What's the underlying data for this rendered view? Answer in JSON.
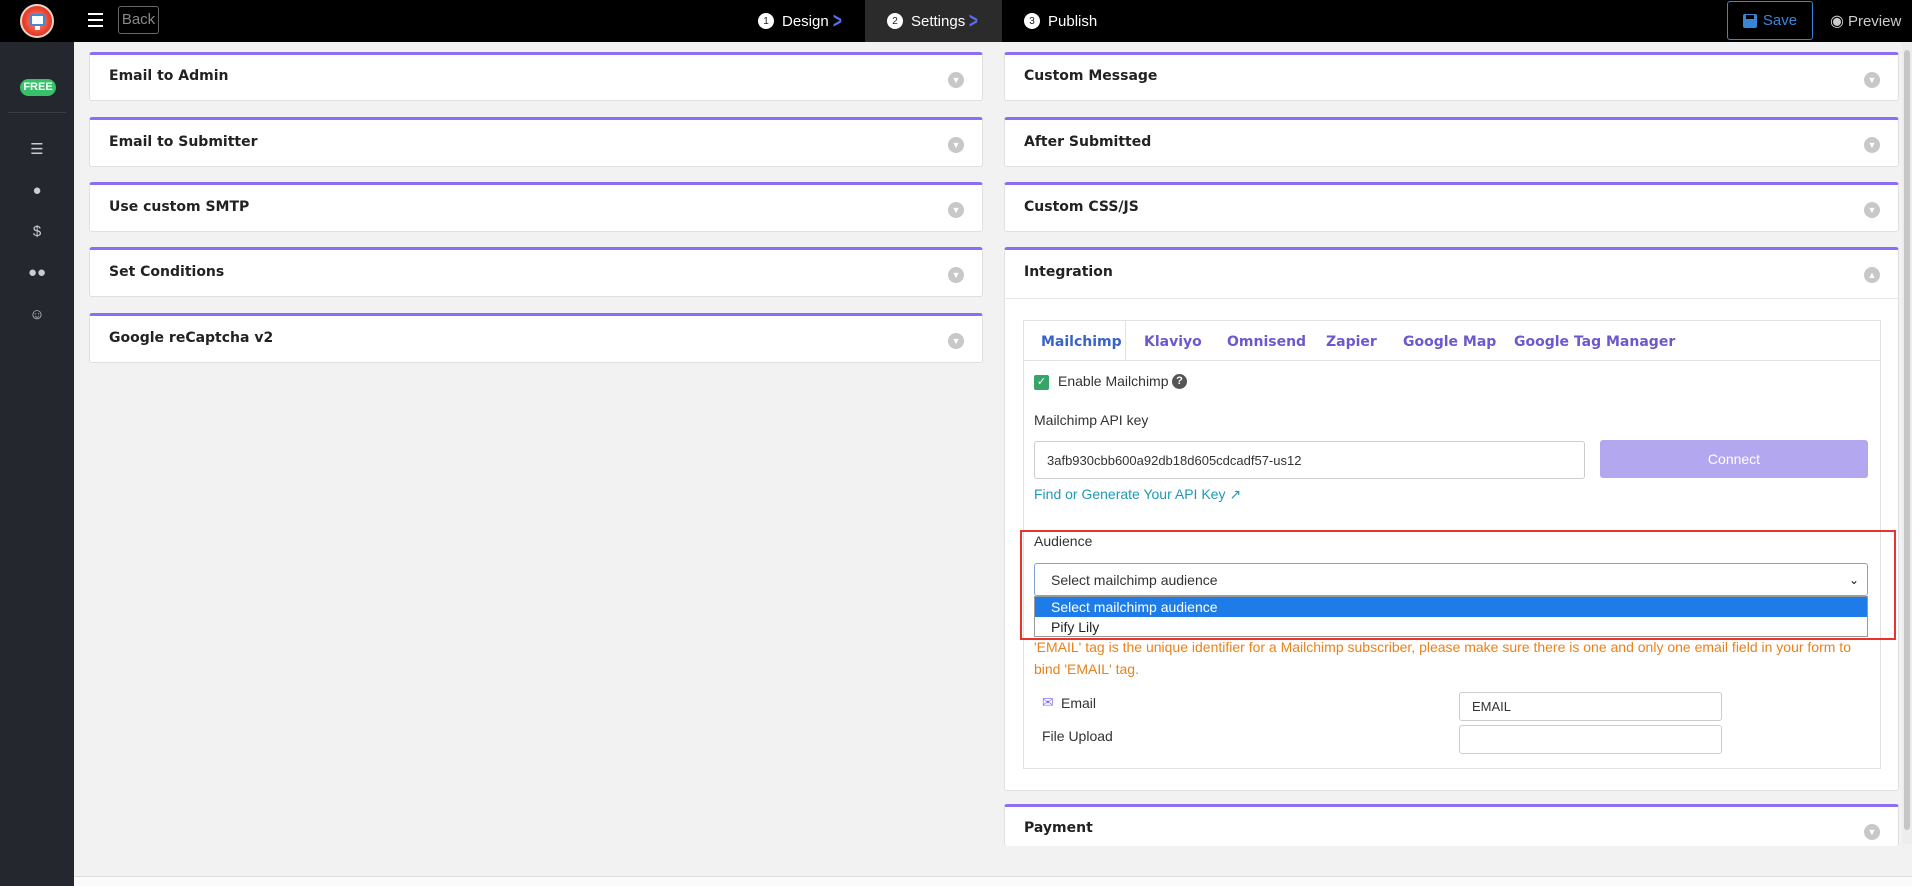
{
  "topbar": {
    "back_label": "Back",
    "steps": [
      {
        "num": "1",
        "label": "Design"
      },
      {
        "num": "2",
        "label": "Settings"
      },
      {
        "num": "3",
        "label": "Publish"
      }
    ],
    "save_label": "Save",
    "preview_label": "Preview"
  },
  "sidebar": {
    "badge": "FREE",
    "icons": [
      "list-icon",
      "user-icon",
      "dollar-icon",
      "users-icon",
      "smile-icon"
    ]
  },
  "left_panels": [
    {
      "title": "Email to Admin"
    },
    {
      "title": "Email to Submitter"
    },
    {
      "title": "Use custom SMTP"
    },
    {
      "title": "Set Conditions"
    },
    {
      "title": "Google reCaptcha v2"
    }
  ],
  "right_panels": [
    {
      "title": "Custom Message"
    },
    {
      "title": "After Submitted"
    },
    {
      "title": "Custom CSS/JS"
    },
    {
      "title": "Integration"
    },
    {
      "title": "Payment"
    }
  ],
  "integration": {
    "tabs": [
      "Mailchimp",
      "Klaviyo",
      "Omnisend",
      "Zapier",
      "Google Map",
      "Google Tag Manager"
    ],
    "active_tab": "Mailchimp",
    "enable_label": "Enable Mailchimp",
    "enabled": true,
    "api_key_label": "Mailchimp API key",
    "api_key_value": "3afb930cbb600a92db18d605cdcadf57-us12",
    "connect_label": "Connect",
    "api_link": "Find or Generate Your API Key",
    "audience_label": "Audience",
    "audience_selected": "Select mailchimp audience",
    "audience_options": [
      "Select mailchimp audience",
      "Pify Lily"
    ],
    "note": "'EMAIL' tag is the unique identifier for a Mailchimp subscriber, please make sure there is one and only one email field in your form to bind 'EMAIL' tag.",
    "fields": [
      {
        "label": "Email",
        "value": "EMAIL"
      },
      {
        "label": "File Upload",
        "value": ""
      }
    ]
  },
  "colors": {
    "accent": "#8b6ff0",
    "highlight_box": "#e8332f",
    "note": "#e8821c",
    "link": "#1d9ab5"
  }
}
